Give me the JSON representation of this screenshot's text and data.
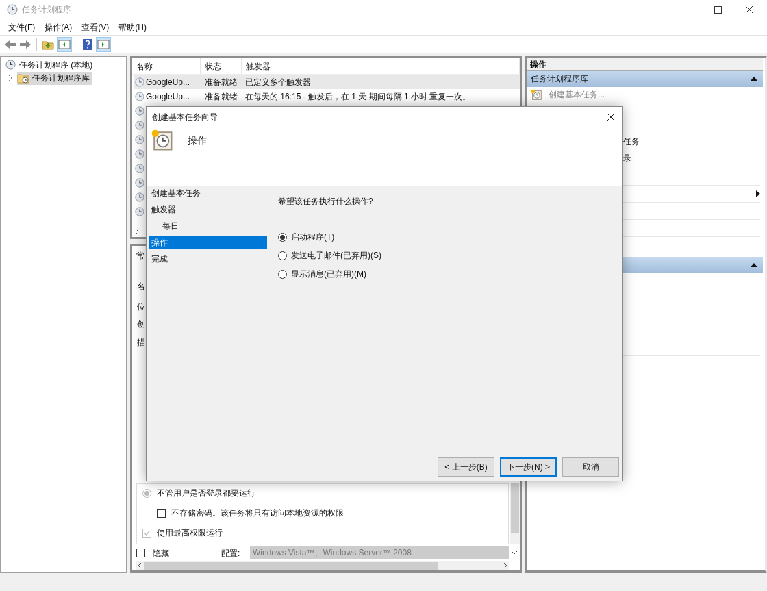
{
  "window": {
    "title": "任务计划程序"
  },
  "menu": [
    "文件(F)",
    "操作(A)",
    "查看(V)",
    "帮助(H)"
  ],
  "tree": [
    {
      "label": "任务计划程序 (本地)",
      "selected": false,
      "children": [
        {
          "label": "任务计划程序库",
          "selected": true,
          "expanded": false
        }
      ]
    }
  ],
  "task_table": {
    "columns": [
      "名称",
      "状态",
      "触发器"
    ],
    "rows": [
      {
        "name": "GoogleUp...",
        "status": "准备就绪",
        "trigger": "已定义多个触发器",
        "selected": true
      },
      {
        "name": "GoogleUp...",
        "status": "准备就绪",
        "trigger": "在每天的 16:15 - 触发后，在 1 天 期间每隔 1 小时 重复一次。",
        "selected": false
      }
    ]
  },
  "details": {
    "tab_fragment": "常",
    "label_fragments": [
      "名",
      "位",
      "创",
      "描"
    ],
    "run_options": [
      {
        "kind": "radio",
        "label": "不管用户是否登录都要运行",
        "checked": true
      },
      {
        "kind": "subcheckbox",
        "label": "不存储密码。该任务将只有访问本地资源的权限",
        "checked": false
      },
      {
        "kind": "checkbox",
        "label": "使用最高权限运行",
        "checked": true
      }
    ],
    "hidden": {
      "label": "隐藏",
      "checked": false
    },
    "config": {
      "label": "配置:",
      "value": "Windows Vista™、Windows Server™ 2008"
    }
  },
  "actions_panel": {
    "title": "操作",
    "sections": [
      {
        "title": "任务计划程序库",
        "expanded": true,
        "items": [
          {
            "label": "创建基本任务...",
            "disabled": true
          }
        ]
      }
    ],
    "fragments": [
      "任务",
      "录"
    ]
  },
  "dialog": {
    "title": "创建基本任务向导",
    "heading": "操作",
    "steps": [
      {
        "label": "创建基本任务",
        "selected": false
      },
      {
        "label": "触发器",
        "selected": false,
        "children": [
          {
            "label": "每日",
            "selected": false
          }
        ]
      },
      {
        "label": "操作",
        "selected": true
      },
      {
        "label": "完成",
        "selected": false
      }
    ],
    "question": "希望该任务执行什么操作?",
    "options": [
      {
        "label": "启动程序(T)",
        "selected": true
      },
      {
        "label": "发送电子邮件(已弃用)(S)",
        "selected": false
      },
      {
        "label": "显示消息(已弃用)(M)",
        "selected": false
      }
    ],
    "buttons": [
      {
        "label": "< 上一步(B)",
        "default": false
      },
      {
        "label": "下一步(N) >",
        "default": true
      },
      {
        "label": "取消",
        "default": false
      }
    ]
  }
}
